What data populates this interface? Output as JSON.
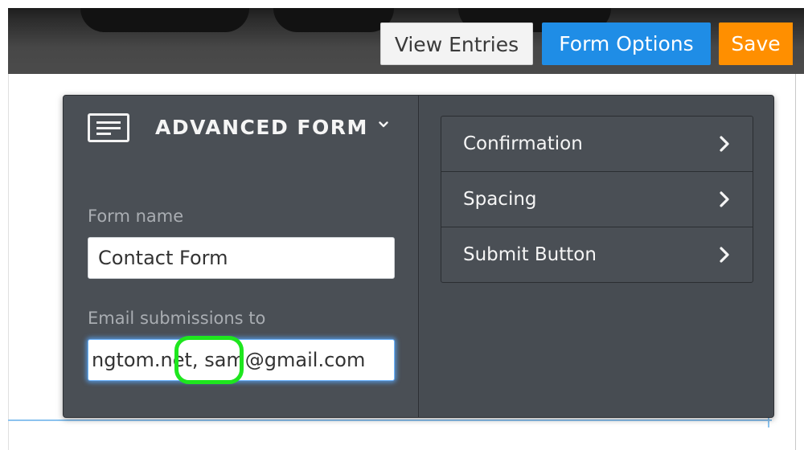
{
  "toolbar": {
    "view_entries_label": "View Entries",
    "form_options_label": "Form Options",
    "save_label": "Save"
  },
  "panel": {
    "title": "ADVANCED FORM",
    "title_icon": "form-icon",
    "dropdown_icon": "chevron-down-icon",
    "form_name": {
      "label": "Form name",
      "value": "Contact Form"
    },
    "email_submissions": {
      "label": "Email submissions to",
      "value": "ngtom.net, sam@gmail.com"
    },
    "menu": {
      "items": [
        {
          "label": "Confirmation",
          "icon": "chevron-right-icon"
        },
        {
          "label": "Spacing",
          "icon": "chevron-right-icon"
        },
        {
          "label": "Submit Button",
          "icon": "chevron-right-icon"
        }
      ]
    }
  },
  "colors": {
    "header_dark": "#474747",
    "panel_bg": "#4a4f55",
    "view_entries_bg": "#f3f3f3",
    "form_options_bg": "#1f8de6",
    "save_bg": "#ff8f00",
    "highlight_ring": "#1ee61e",
    "focus_glow": "#6fb6ff",
    "guide_line": "#8cc3ef"
  }
}
